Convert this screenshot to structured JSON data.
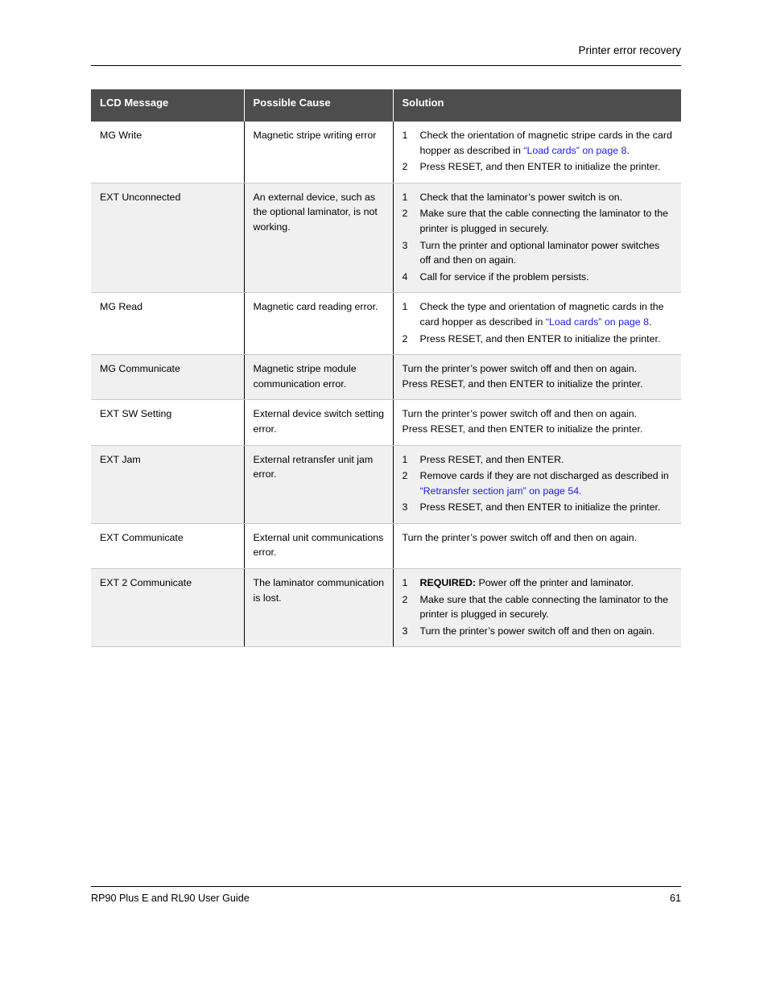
{
  "page": {
    "running_header": "Printer error recovery",
    "footer_title": "RP90 Plus E and RL90 User Guide",
    "page_number": "61"
  },
  "colors": {
    "header_bg": "#4d4d4d",
    "header_text": "#ffffff",
    "alt_row_bg": "#f0f0f0",
    "link": "#1a1ae6",
    "body_text": "#000000"
  },
  "table": {
    "columns": [
      "LCD Message",
      "Possible Cause",
      "Solution"
    ],
    "rows": [
      {
        "lcd_message": "MG Write",
        "possible_cause": "Magnetic stripe writing error",
        "solution_type": "steps",
        "steps": [
          {
            "parts": [
              {
                "text": "Check the orientation of magnetic stripe cards in the card hopper as described in ",
                "style": "plain"
              },
              {
                "text": "“Load cards” on page 8",
                "style": "link"
              },
              {
                "text": ".",
                "style": "plain"
              }
            ]
          },
          {
            "parts": [
              {
                "text": "Press RESET, and then ENTER to initialize the printer.",
                "style": "plain"
              }
            ]
          }
        ]
      },
      {
        "lcd_message": "EXT Unconnected",
        "possible_cause": "An external device, such as the optional laminator, is not working.",
        "solution_type": "steps",
        "steps": [
          {
            "parts": [
              {
                "text": "Check that the laminator’s power switch is on.",
                "style": "plain"
              }
            ]
          },
          {
            "parts": [
              {
                "text": "Make sure that the cable connecting the laminator to the printer is plugged in securely.",
                "style": "plain"
              }
            ]
          },
          {
            "parts": [
              {
                "text": "Turn the printer and optional laminator power switches off and then on again.",
                "style": "plain"
              }
            ]
          },
          {
            "parts": [
              {
                "text": "Call for service if the problem persists.",
                "style": "plain"
              }
            ]
          }
        ]
      },
      {
        "lcd_message": "MG Read",
        "possible_cause": "Magnetic card reading error.",
        "solution_type": "steps",
        "steps": [
          {
            "parts": [
              {
                "text": "Check the type and orientation of magnetic cards in the card hopper as described in ",
                "style": "plain"
              },
              {
                "text": "“Load cards” on page 8",
                "style": "link"
              },
              {
                "text": ".",
                "style": "plain"
              }
            ]
          },
          {
            "parts": [
              {
                "text": "Press RESET, and then ENTER to initialize the printer.",
                "style": "plain"
              }
            ]
          }
        ]
      },
      {
        "lcd_message": "MG Communicate",
        "possible_cause": "Magnetic stripe module communication error.",
        "solution_type": "plain",
        "paragraphs": [
          "Turn the printer’s power switch off and then on again.",
          "Press RESET, and then ENTER to initialize the printer."
        ]
      },
      {
        "lcd_message": "EXT SW Setting",
        "possible_cause": "External device switch setting error.",
        "solution_type": "plain",
        "paragraphs": [
          "Turn the printer’s power switch off and then on again.",
          "Press RESET, and then ENTER to initialize the printer."
        ]
      },
      {
        "lcd_message": "EXT Jam",
        "possible_cause": "External retransfer unit jam error.",
        "solution_type": "steps",
        "steps": [
          {
            "parts": [
              {
                "text": "Press RESET, and then ENTER.",
                "style": "plain"
              }
            ]
          },
          {
            "parts": [
              {
                "text": "Remove cards if they are not discharged as described in ",
                "style": "plain"
              },
              {
                "text": "“Retransfer section jam” on page 54.",
                "style": "link"
              }
            ]
          },
          {
            "parts": [
              {
                "text": "Press RESET, and then ENTER to initialize the printer.",
                "style": "plain"
              }
            ]
          }
        ]
      },
      {
        "lcd_message": "EXT Communicate",
        "possible_cause": "External unit communications error.",
        "solution_type": "plain",
        "paragraphs": [
          "Turn the printer’s power switch off and then on again."
        ]
      },
      {
        "lcd_message": "EXT 2 Communicate",
        "possible_cause": "The laminator communication is lost.",
        "solution_type": "steps",
        "steps": [
          {
            "parts": [
              {
                "text": "REQUIRED:",
                "style": "bold"
              },
              {
                "text": " Power off the printer and laminator.",
                "style": "plain"
              }
            ]
          },
          {
            "parts": [
              {
                "text": "Make sure that the cable connecting the laminator to the printer is plugged in securely.",
                "style": "plain"
              }
            ]
          },
          {
            "parts": [
              {
                "text": "Turn the printer’s power switch off and then on again.",
                "style": "plain"
              }
            ]
          }
        ]
      }
    ]
  }
}
